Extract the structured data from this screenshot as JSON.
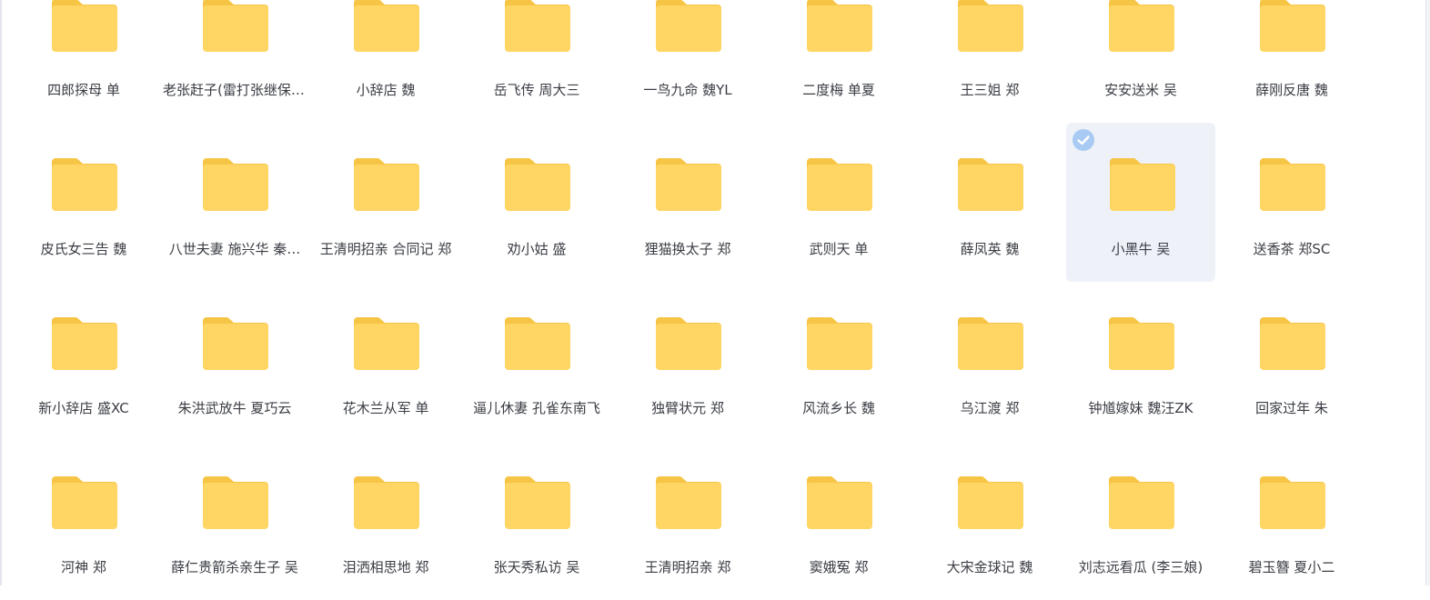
{
  "colors": {
    "folder_front": "#ffd664",
    "folder_back": "#f7c546",
    "selection_bg": "#eef2f8",
    "check_badge": "#a9cbf3",
    "label_text": "#3a3d44"
  },
  "folders": [
    {
      "label": "四郎探母 单",
      "icon": "folder-icon"
    },
    {
      "label": "老张赶子(雷打张继保) 单",
      "icon": "folder-icon"
    },
    {
      "label": "小辞店 魏",
      "icon": "folder-icon"
    },
    {
      "label": "岳飞传 周大三",
      "icon": "folder-icon"
    },
    {
      "label": "一鸟九命 魏YL",
      "icon": "folder-icon"
    },
    {
      "label": "二度梅 单夏",
      "icon": "folder-icon"
    },
    {
      "label": "王三姐 郑",
      "icon": "folder-icon"
    },
    {
      "label": "安安送米 吴",
      "icon": "folder-icon"
    },
    {
      "label": "薛刚反唐 魏",
      "icon": "folder-icon"
    },
    {
      "label": "皮氏女三告 魏",
      "icon": "folder-icon"
    },
    {
      "label": "八世夫妻 施兴华 秦…",
      "icon": "folder-icon"
    },
    {
      "label": "王清明招亲 合同记 郑",
      "icon": "folder-icon"
    },
    {
      "label": "劝小姑 盛",
      "icon": "folder-icon"
    },
    {
      "label": "狸猫换太子 郑",
      "icon": "folder-icon"
    },
    {
      "label": "武则天 单",
      "icon": "folder-icon"
    },
    {
      "label": "薛凤英 魏",
      "icon": "folder-icon"
    },
    {
      "label": "小黑牛 吴",
      "icon": "folder-icon",
      "selected": true
    },
    {
      "label": "送香茶 郑SC",
      "icon": "folder-icon"
    },
    {
      "label": "新小辞店 盛XC",
      "icon": "folder-icon"
    },
    {
      "label": "朱洪武放牛 夏巧云",
      "icon": "folder-icon"
    },
    {
      "label": "花木兰从军 单",
      "icon": "folder-icon"
    },
    {
      "label": "逼儿休妻 孔雀东南飞",
      "icon": "folder-icon"
    },
    {
      "label": "独臂状元 郑",
      "icon": "folder-icon"
    },
    {
      "label": "风流乡长 魏",
      "icon": "folder-icon"
    },
    {
      "label": "乌江渡 郑",
      "icon": "folder-icon"
    },
    {
      "label": "钟馗嫁妹 魏汪ZK",
      "icon": "folder-icon"
    },
    {
      "label": "回家过年 朱",
      "icon": "folder-icon"
    },
    {
      "label": "河神 郑",
      "icon": "folder-icon"
    },
    {
      "label": "薛仁贵箭杀亲生子 吴",
      "icon": "folder-icon"
    },
    {
      "label": "泪洒相思地 郑",
      "icon": "folder-icon"
    },
    {
      "label": "张天秀私访 吴",
      "icon": "folder-icon"
    },
    {
      "label": "王清明招亲 郑",
      "icon": "folder-icon"
    },
    {
      "label": "窦娥冤 郑",
      "icon": "folder-icon"
    },
    {
      "label": "大宋金球记 魏",
      "icon": "folder-icon"
    },
    {
      "label": "刘志远看瓜 (李三娘)",
      "icon": "folder-icon"
    },
    {
      "label": "碧玉簪 夏小二",
      "icon": "folder-icon"
    }
  ]
}
